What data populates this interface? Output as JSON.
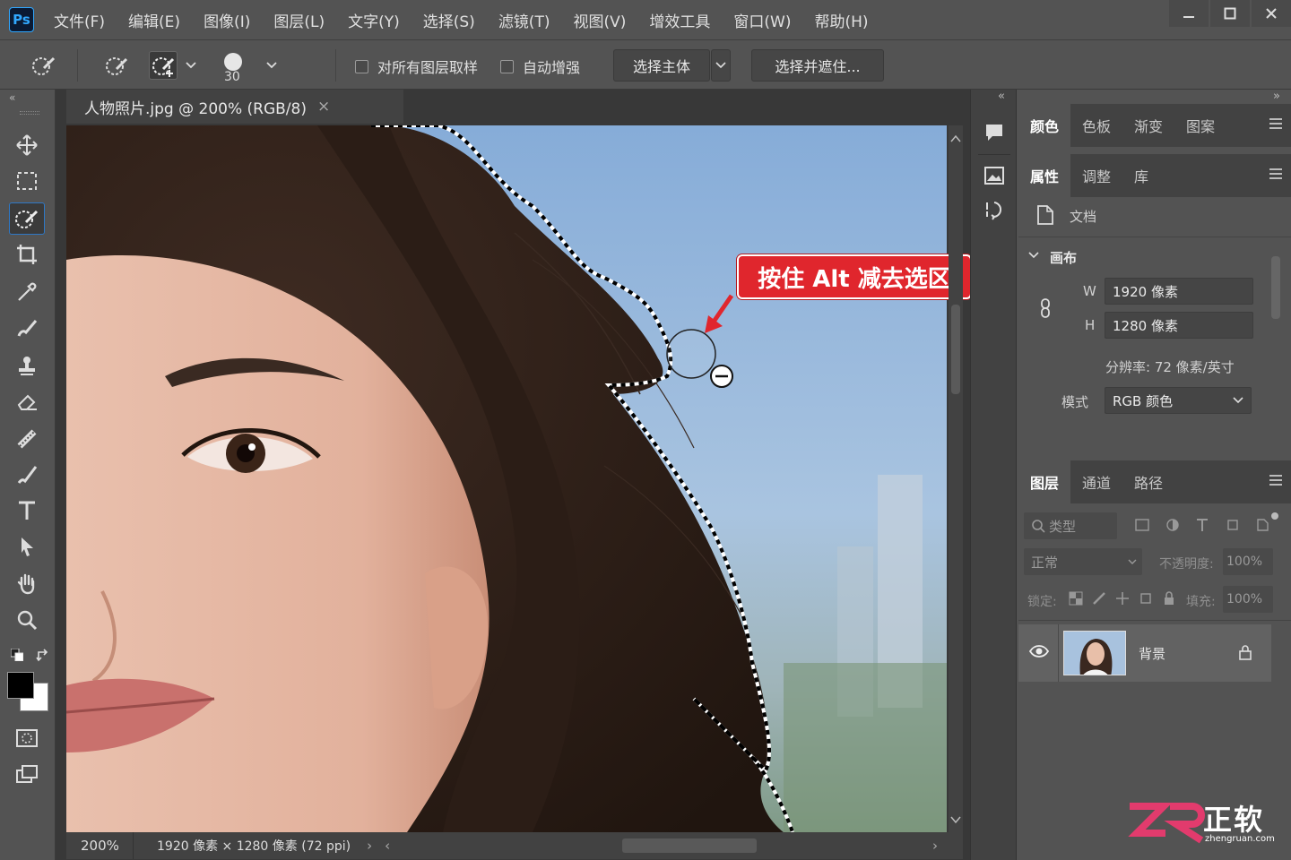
{
  "app": {
    "logo_text": "Ps"
  },
  "menubar": {
    "items": [
      "文件(F)",
      "编辑(E)",
      "图像(I)",
      "图层(L)",
      "文字(Y)",
      "选择(S)",
      "滤镜(T)",
      "视图(V)",
      "增效工具",
      "窗口(W)",
      "帮助(H)"
    ],
    "window_controls": [
      "minimize-icon",
      "maximize-icon",
      "close-icon"
    ]
  },
  "options": {
    "brush_size": "30",
    "sample_all_layers": "对所有图层取样",
    "auto_enhance": "自动增强",
    "select_subject": "选择主体",
    "select_and_mask": "选择并遮住..."
  },
  "document": {
    "tab_title": "人物照片.jpg @ 200% (RGB/8)",
    "close_glyph": "×",
    "zoom": "200%",
    "info": "1920 像素 × 1280 像素 (72 ppi)"
  },
  "annotation": {
    "callout": "按住 Alt 减去选区"
  },
  "panels": {
    "color_tabs": [
      "颜色",
      "色板",
      "渐变",
      "图案"
    ],
    "properties_tabs": [
      "属性",
      "调整",
      "库"
    ],
    "doc_label": "文档",
    "canvas_section": "画布",
    "width_label": "W",
    "width_value": "1920 像素",
    "height_label": "H",
    "height_value": "1280 像素",
    "resolution": "分辨率: 72 像素/英寸",
    "mode_label": "模式",
    "mode_value": "RGB 颜色",
    "layers_tabs": [
      "图层",
      "通道",
      "路径"
    ],
    "filter_type": "类型",
    "blend_mode": "正常",
    "opacity_label": "不透明度:",
    "opacity_value": "100%",
    "lock_label": "锁定:",
    "fill_label": "填充:",
    "fill_value": "100%",
    "layer_name": "背景"
  },
  "watermark": {
    "brand": "正软",
    "url": "zhengruan.com"
  },
  "colors": {
    "accent": "#e0262d",
    "selection_active": "#2e78c6",
    "ps_blue": "#31a8ff"
  }
}
